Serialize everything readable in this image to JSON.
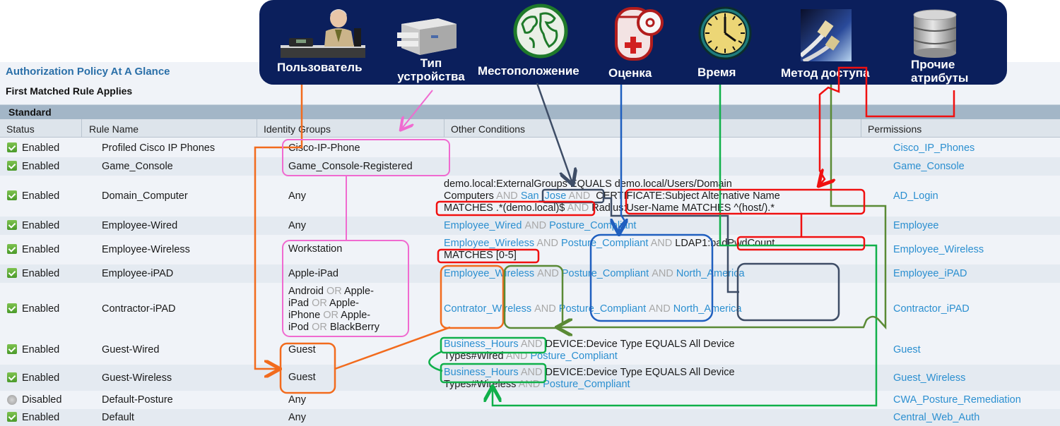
{
  "banner": {
    "items": [
      {
        "label": "Пользователь",
        "icon": "user-at-desk-icon"
      },
      {
        "label_line1": "Тип",
        "label_line2": "устройства",
        "icon": "device-printer-icon"
      },
      {
        "label": "Местоположение",
        "icon": "globe-icon"
      },
      {
        "label": "Оценка",
        "icon": "posture-assessment-icon"
      },
      {
        "label": "Время",
        "icon": "clock-icon"
      },
      {
        "label": "Метод доступа",
        "icon": "network-cable-icon"
      },
      {
        "label_line1": "Прочие",
        "label_line2": "атрибуты",
        "icon": "database-icon"
      }
    ]
  },
  "panel": {
    "title": "Authorization Policy At A Glance",
    "subtitle": "First Matched Rule Applies",
    "section": "Standard"
  },
  "columns": [
    "Status",
    "Rule Name",
    "Identity Groups",
    "Other Conditions",
    "Permissions"
  ],
  "rows": [
    {
      "status": "Enabled",
      "name": "Profiled Cisco IP Phones",
      "identity": "Cisco-IP-Phone",
      "permission": "Cisco_IP_Phones"
    },
    {
      "status": "Enabled",
      "name": "Game_Console",
      "identity": "Game_Console-Registered",
      "permission": "Game_Console"
    },
    {
      "status": "Enabled",
      "name": "Domain_Computer",
      "identity": "Any",
      "permission": "AD_Login",
      "cond": {
        "l1": "demo.local:ExternalGroups EQUALS demo.local/Users/Domain",
        "l2a": "Computers",
        "op1": "AND",
        "l2b": "San_Jose",
        "op2": "AND",
        "l2c": "CERTIFICATE:Subject Alternative Name",
        "l3a": "MATCHES .*(demo.local)$",
        "op3": "AND",
        "l3b": "Radius:User-Name MATCHES ^(host/).*"
      }
    },
    {
      "status": "Enabled",
      "name": "Employee-Wired",
      "identity": "Any",
      "permission": "Employee",
      "cond": {
        "a": "Employee_Wired",
        "op": "AND",
        "b": "Posture_Compliant"
      }
    },
    {
      "status": "Enabled",
      "name": "Employee-Wireless",
      "identity": "Workstation",
      "permission": "Employee_Wireless",
      "cond": {
        "a": "Employee_Wireless",
        "op1": "AND",
        "b": "Posture_Compliant",
        "op2": "AND",
        "c": "LDAP1:badPwdCount",
        "l2": "MATCHES [0-5]"
      }
    },
    {
      "status": "Enabled",
      "name": "Employee-iPAD",
      "identity": "Apple-iPad",
      "permission": "Employee_iPAD",
      "cond": {
        "a": "Employee_Wireless",
        "op1": "AND",
        "b": "Posture_Compliant",
        "op2": "AND",
        "c": "North_America"
      }
    },
    {
      "status": "Enabled",
      "name": "Contractor-iPAD",
      "permission": "Contractor_iPAD",
      "identity_lines": [
        [
          "Android",
          "OR",
          "Apple-"
        ],
        [
          "iPad",
          "OR",
          "Apple-"
        ],
        [
          "iPhone",
          "OR",
          "Apple-"
        ],
        [
          "iPod",
          "OR",
          "BlackBerry"
        ]
      ],
      "cond": {
        "a": "Contrator_Wireless",
        "op1": "AND",
        "b": "Posture_Compliant",
        "op2": "AND",
        "c": "North_America"
      }
    },
    {
      "status": "Enabled",
      "name": "Guest-Wired",
      "identity": "Guest",
      "permission": "Guest",
      "cond": {
        "a": "Business_Hours",
        "op1": "AND",
        "b": "DEVICE:Device Type EQUALS All Device",
        "l2a": "Types#Wired",
        "op2": "AND",
        "l2b": "Posture_Compliant"
      }
    },
    {
      "status": "Enabled",
      "name": "Guest-Wireless",
      "identity": "Guest",
      "permission": "Guest_Wireless",
      "cond": {
        "a": "Business_Hours",
        "op1": "AND",
        "b": "DEVICE:Device Type EQUALS All Device",
        "l2a": "Types#Wireless",
        "op2": "AND",
        "l2b": "Posture_Compliant"
      }
    },
    {
      "status": "Disabled",
      "name": "Default-Posture",
      "identity": "Any",
      "permission": "CWA_Posture_Remediation"
    },
    {
      "status": "Enabled",
      "name": "Default",
      "identity": "Any",
      "permission": "Central_Web_Auth"
    }
  ],
  "annotation_colors": {
    "user": "#f26b1d",
    "device_type": "#f06ad0",
    "location": "#3e4d66",
    "posture": "#1f5fbf",
    "time": "#10b04a",
    "access_method": "#5a8a35",
    "other": "#f01010"
  }
}
